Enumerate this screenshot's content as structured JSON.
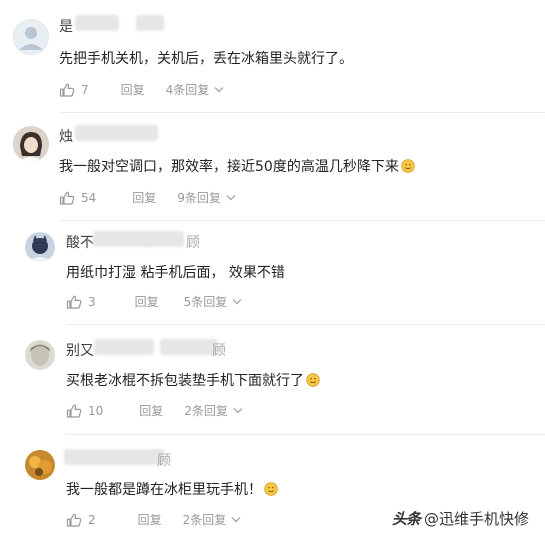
{
  "comments": [
    {
      "user_prefix": "是",
      "text": "先把手机关机，关机后，丢在冰箱里头就行了。",
      "likes": "7",
      "reply_label": "回复",
      "replies_label": "4条回复"
    },
    {
      "user_prefix": "烛",
      "text": "我一般对空调口，那效率，接近50度的高温几秒降下来",
      "likes": "54",
      "reply_label": "回复",
      "replies_label": "9条回复"
    },
    {
      "user_prefix": "酸不",
      "user_suffix": "顾",
      "text": "用纸巾打湿 粘手机后面， 效果不错",
      "likes": "3",
      "reply_label": "回复",
      "replies_label": "5条回复"
    },
    {
      "user_prefix": "别又",
      "user_suffix": "顾",
      "text": "买根老冰棍不拆包装垫手机下面就行了",
      "likes": "10",
      "reply_label": "回复",
      "replies_label": "2条回复"
    },
    {
      "user_prefix": "",
      "user_suffix": "顾",
      "text": "我一般都是蹲在冰柜里玩手机！",
      "likes": "2",
      "reply_label": "回复",
      "replies_label": "2条回复"
    }
  ],
  "watermark": {
    "brand": "头条",
    "account": "@迅维手机快修"
  },
  "colors": {
    "muted": "#999999",
    "divider": "#ececec"
  }
}
